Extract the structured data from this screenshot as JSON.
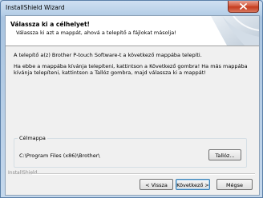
{
  "window": {
    "title": "InstallShield Wizard"
  },
  "header": {
    "title": "Válassza ki a célhelyet!",
    "subtitle": "Válassza ki azt a mappát, ahová a telepítő a fájlokat másolja!"
  },
  "body": {
    "paragraph1": "A telepítő a(z) Brother P-touch Software-t a következő mappába telepíti.",
    "paragraph2": "Ha ebbe a mappába kívánja telepíteni, kattintson a Következő gombra! Ha más mappába kívánja telepíteni, kattintson a Tallóz gombra, majd válassza ki a mappát!"
  },
  "destination": {
    "group_label": "Célmappa",
    "path": "C:\\Program Files (x86)\\Brother\\",
    "browse_label": "Tallóz..."
  },
  "footer": {
    "brand": "InstallShield",
    "back_label": "< Vissza",
    "next_label": "Következő >",
    "cancel_label": "Mégse"
  },
  "icons": {
    "close": "close-icon"
  },
  "colors": {
    "close_button": "#c53b1f",
    "title_bar": "#b4cde6"
  }
}
